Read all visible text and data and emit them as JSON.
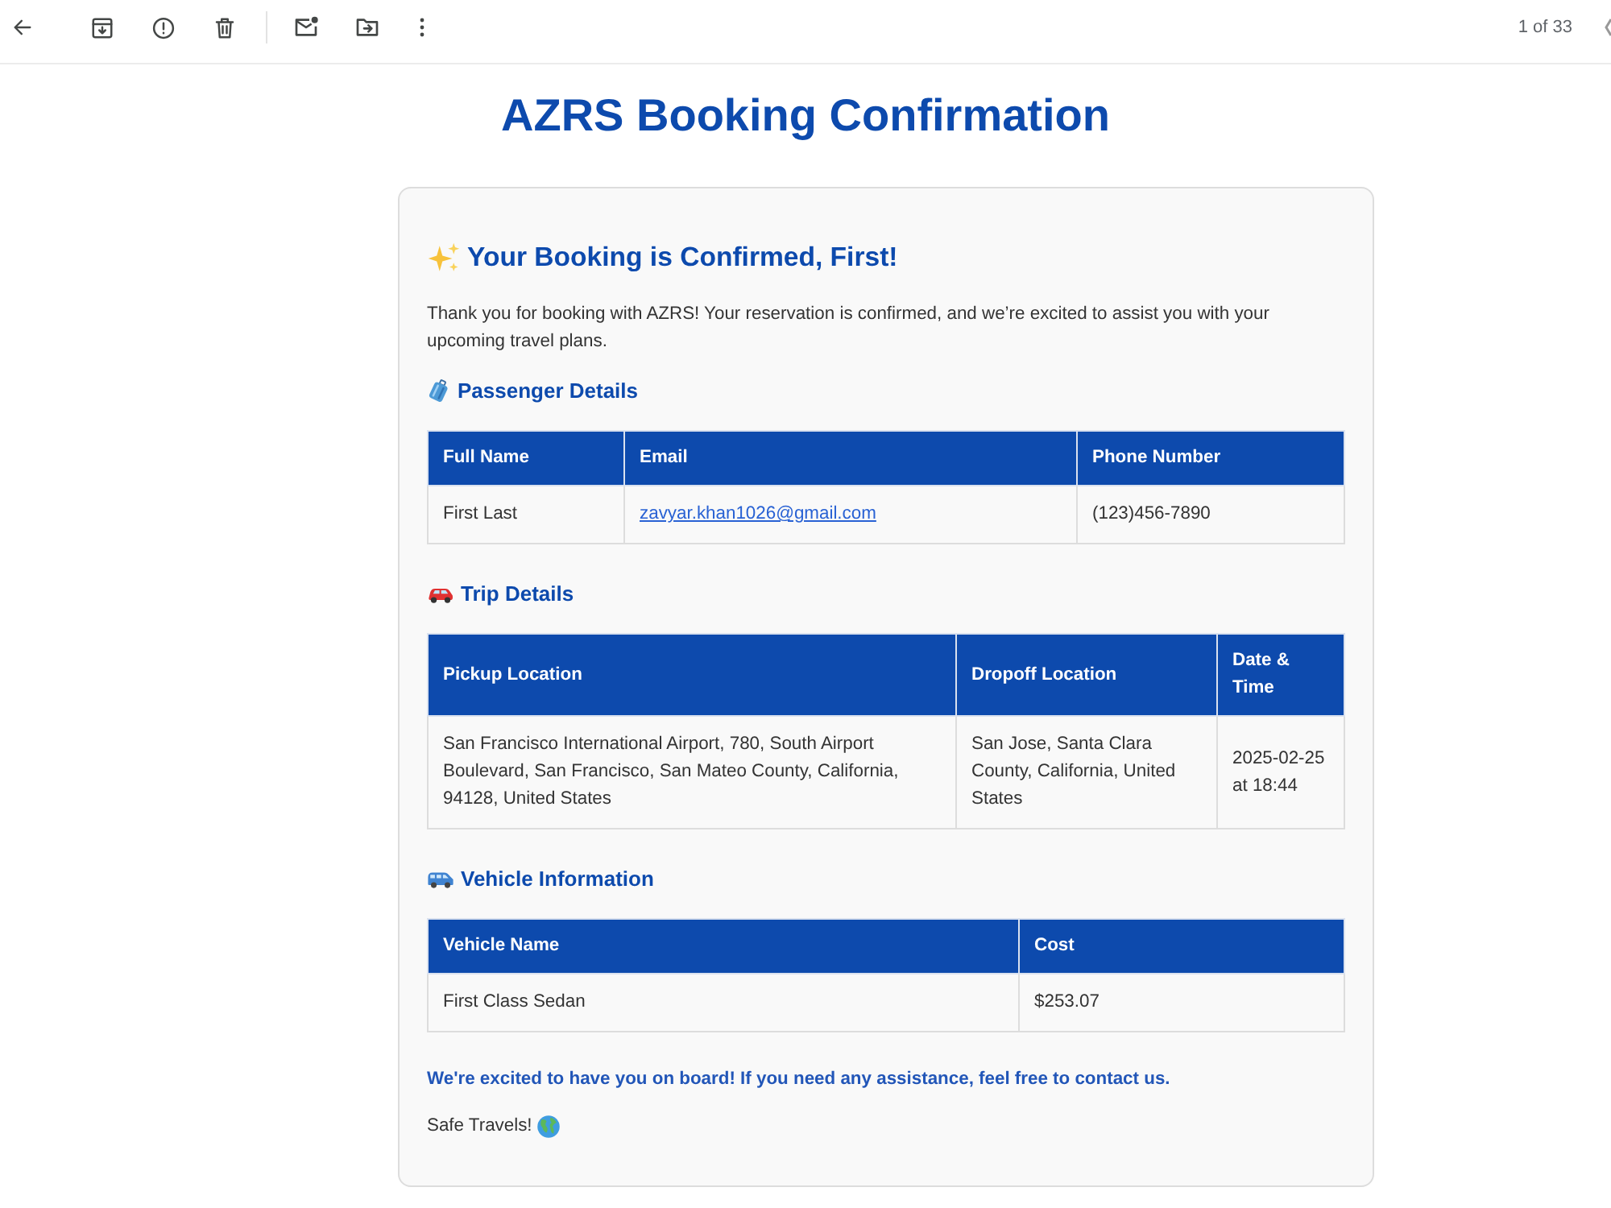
{
  "toolbar": {
    "page_counter": "1 of 33"
  },
  "title": "AZRS Booking Confirmation",
  "card": {
    "heading": "Your Booking is Confirmed, First!",
    "intro": "Thank you for booking with AZRS! Your reservation is confirmed, and we’re excited to assist you with your upcoming travel plans.",
    "sections": [
      {
        "heading": "Passenger Details",
        "table": {
          "columns": [
            "Full Name",
            "Email",
            "Phone Number"
          ],
          "rows": [
            [
              {
                "text": "First Last",
                "kind": "text"
              },
              {
                "text": "zavyar.khan1026@gmail.com",
                "kind": "link"
              },
              {
                "text": "(123)456-7890",
                "kind": "text"
              }
            ]
          ]
        }
      },
      {
        "heading": "Trip Details",
        "table": {
          "columns": [
            "Pickup Location",
            "Dropoff Location",
            "Date & Time"
          ],
          "rows": [
            [
              {
                "text": "San Francisco International Airport, 780, South Airport Boulevard, San Francisco, San Mateo County, California, 94128, United States",
                "kind": "text"
              },
              {
                "text": "San Jose, Santa Clara County, California, United States",
                "kind": "text"
              },
              {
                "text": "2025-02-25 at 18:44",
                "kind": "text"
              }
            ]
          ]
        }
      },
      {
        "heading": "Vehicle Information",
        "table": {
          "columns": [
            "Vehicle Name",
            "Cost"
          ],
          "rows": [
            [
              {
                "text": "First Class Sedan",
                "kind": "text"
              },
              {
                "text": "$253.07",
                "kind": "text"
              }
            ]
          ]
        }
      }
    ],
    "closing": "We're excited to have you on board! If you need any assistance, feel free to contact us.",
    "signoff": "Safe Travels!"
  }
}
